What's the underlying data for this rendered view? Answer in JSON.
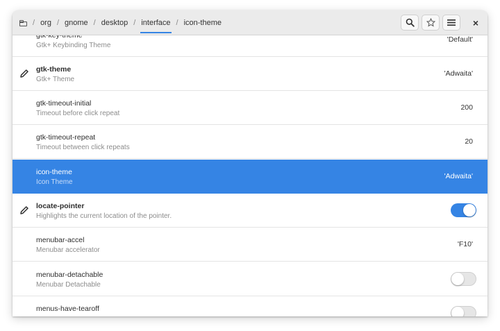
{
  "path": {
    "segments": [
      "org",
      "gnome",
      "desktop",
      "interface",
      "icon-theme"
    ],
    "separator": "/",
    "active_index": 3
  },
  "header_buttons": {
    "search_icon": "search-icon",
    "bookmark_icon": "star-icon",
    "menu_icon": "hamburger-menu-icon",
    "close_icon": "close-icon",
    "close_glyph": "×"
  },
  "rows": [
    {
      "name": "gtk-key-theme",
      "desc": "Gtk+ Keybinding Theme",
      "value": "'Default'",
      "edited": false,
      "bold": false
    },
    {
      "name": "gtk-theme",
      "desc": "Gtk+ Theme",
      "value": "'Adwaita'",
      "edited": true,
      "bold": true
    },
    {
      "name": "gtk-timeout-initial",
      "desc": "Timeout before click repeat",
      "value": "200",
      "edited": false,
      "bold": false
    },
    {
      "name": "gtk-timeout-repeat",
      "desc": "Timeout between click repeats",
      "value": "20",
      "edited": false,
      "bold": false
    },
    {
      "name": "icon-theme",
      "desc": "Icon Theme",
      "value": "'Adwaita'",
      "edited": false,
      "bold": false,
      "selected": true
    },
    {
      "name": "locate-pointer",
      "desc": "Highlights the current location of the pointer.",
      "toggle": true,
      "edited": true,
      "bold": true
    },
    {
      "name": "menubar-accel",
      "desc": "Menubar accelerator",
      "value": "'F10'",
      "edited": false,
      "bold": false
    },
    {
      "name": "menubar-detachable",
      "desc": "Menubar Detachable",
      "toggle": false,
      "edited": false,
      "bold": false
    },
    {
      "name": "menus-have-tearoff",
      "desc": "",
      "toggle": false,
      "edited": false,
      "bold": false
    }
  ],
  "colors": {
    "accent": "#3584e4",
    "headerbar": "#ebebeb"
  }
}
